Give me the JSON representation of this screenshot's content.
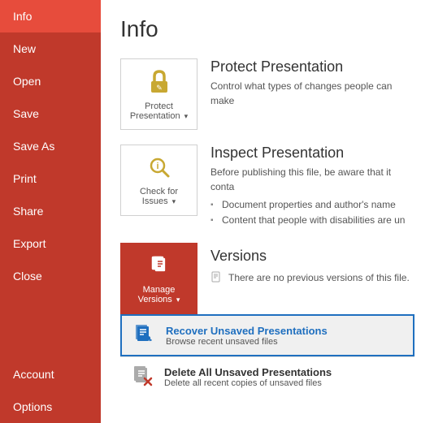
{
  "sidebar": {
    "items": [
      {
        "id": "info",
        "label": "Info",
        "active": true
      },
      {
        "id": "new",
        "label": "New"
      },
      {
        "id": "open",
        "label": "Open"
      },
      {
        "id": "save",
        "label": "Save"
      },
      {
        "id": "save-as",
        "label": "Save As"
      },
      {
        "id": "print",
        "label": "Print"
      },
      {
        "id": "share",
        "label": "Share"
      },
      {
        "id": "export",
        "label": "Export"
      },
      {
        "id": "close",
        "label": "Close"
      }
    ],
    "bottomItems": [
      {
        "id": "account",
        "label": "Account"
      },
      {
        "id": "options",
        "label": "Options"
      }
    ]
  },
  "main": {
    "title": "Info",
    "sections": {
      "protect": {
        "label": "Protect\nPresentation",
        "button_label": "Protect Presentation",
        "description": "Control what types of changes people can make"
      },
      "inspect": {
        "label": "Check for\nIssues",
        "button_label": "Inspect Presentation",
        "description": "Before publishing this file, be aware that it conta",
        "bullets": [
          "Document properties and author's name",
          "Content that people with disabilities are un"
        ]
      },
      "versions": {
        "label": "Manage\nVersions",
        "button_label": "Versions",
        "no_versions_text": "There are no previous versions of this file."
      }
    },
    "actions": {
      "recover": {
        "label": "Recover Unsaved Presentations",
        "description": "Browse recent unsaved files"
      },
      "delete": {
        "label": "Delete All Unsaved Presentations",
        "description": "Delete all recent copies of unsaved files"
      }
    }
  }
}
